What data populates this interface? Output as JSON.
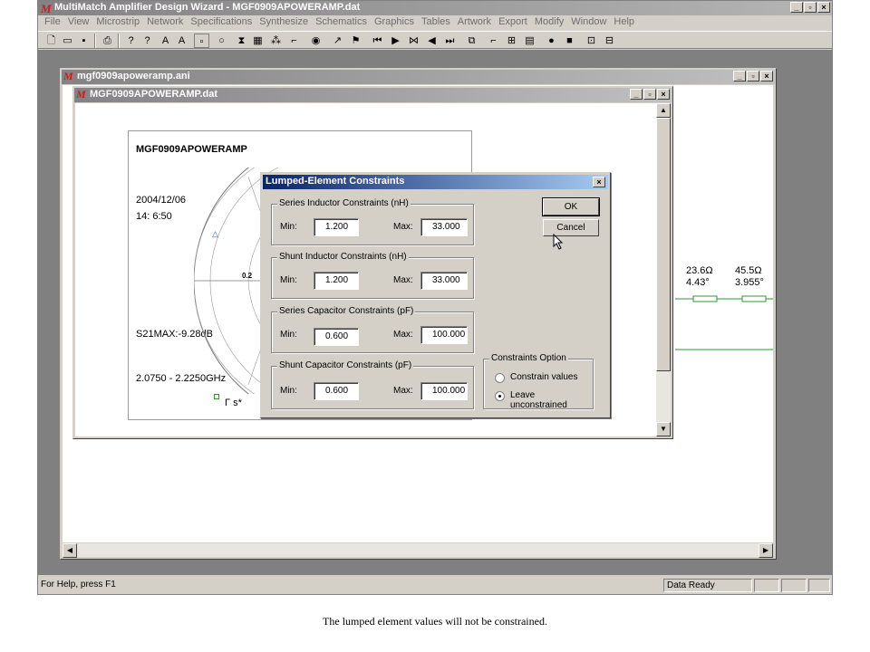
{
  "app": {
    "title": "MultiMatch Amplifier Design Wizard - MGF0909APOWERAMP.dat",
    "icon": "M",
    "min": "_",
    "restore": "▫",
    "close": "×"
  },
  "menu": [
    "File",
    "View",
    "Microstrip",
    "Network",
    "Specifications",
    "Synthesize",
    "Schematics",
    "Graphics",
    "Tables",
    "Artwork",
    "Export",
    "Modify",
    "Window",
    "Help"
  ],
  "win_ani": {
    "title": "mgf0909apoweramp.ani"
  },
  "win_dat": {
    "title": "MGF0909APOWERAMP.dat"
  },
  "smith": {
    "title": "MGF0909APOWERAMP",
    "date": "2004/12/06",
    "time": "14: 6:50",
    "gridlabel": "0.2",
    "s21": "S21MAX:-9.28dB",
    "freq": "2.0750 - 2.2250GHz",
    "legend": "Γ s*"
  },
  "schematic": {
    "z1": "23.6Ω",
    "a1": "4.43°",
    "z2": "45.5Ω",
    "a2": "3.955°"
  },
  "dialog": {
    "title": "Lumped-Element Constraints",
    "close": "×",
    "ok": "OK",
    "cancel": "Cancel",
    "groups": [
      {
        "label": "Series Inductor Constraints (nH)",
        "min_label": "Min:",
        "min": "1.200",
        "max_label": "Max:",
        "max": "33.000"
      },
      {
        "label": "Shunt Inductor Constraints (nH)",
        "min_label": "Min:",
        "min": "1.200",
        "max_label": "Max:",
        "max": "33.000"
      },
      {
        "label": "Series Capacitor Constraints (pF)",
        "min_label": "Min:",
        "min": "0.600",
        "max_label": "Max:",
        "max": "100.000"
      },
      {
        "label": "Shunt Capacitor Constraints (pF)",
        "min_label": "Min:",
        "min": "0.600",
        "max_label": "Max:",
        "max": "100.000"
      }
    ],
    "options": {
      "label": "Constraints Option",
      "constrain": "Constrain values",
      "unconstrained": "Leave unconstrained",
      "selected": "unconstrained"
    }
  },
  "status": {
    "help": "For Help, press F1",
    "state": "Data Ready"
  },
  "caption": "The lumped element values will not be constrained."
}
